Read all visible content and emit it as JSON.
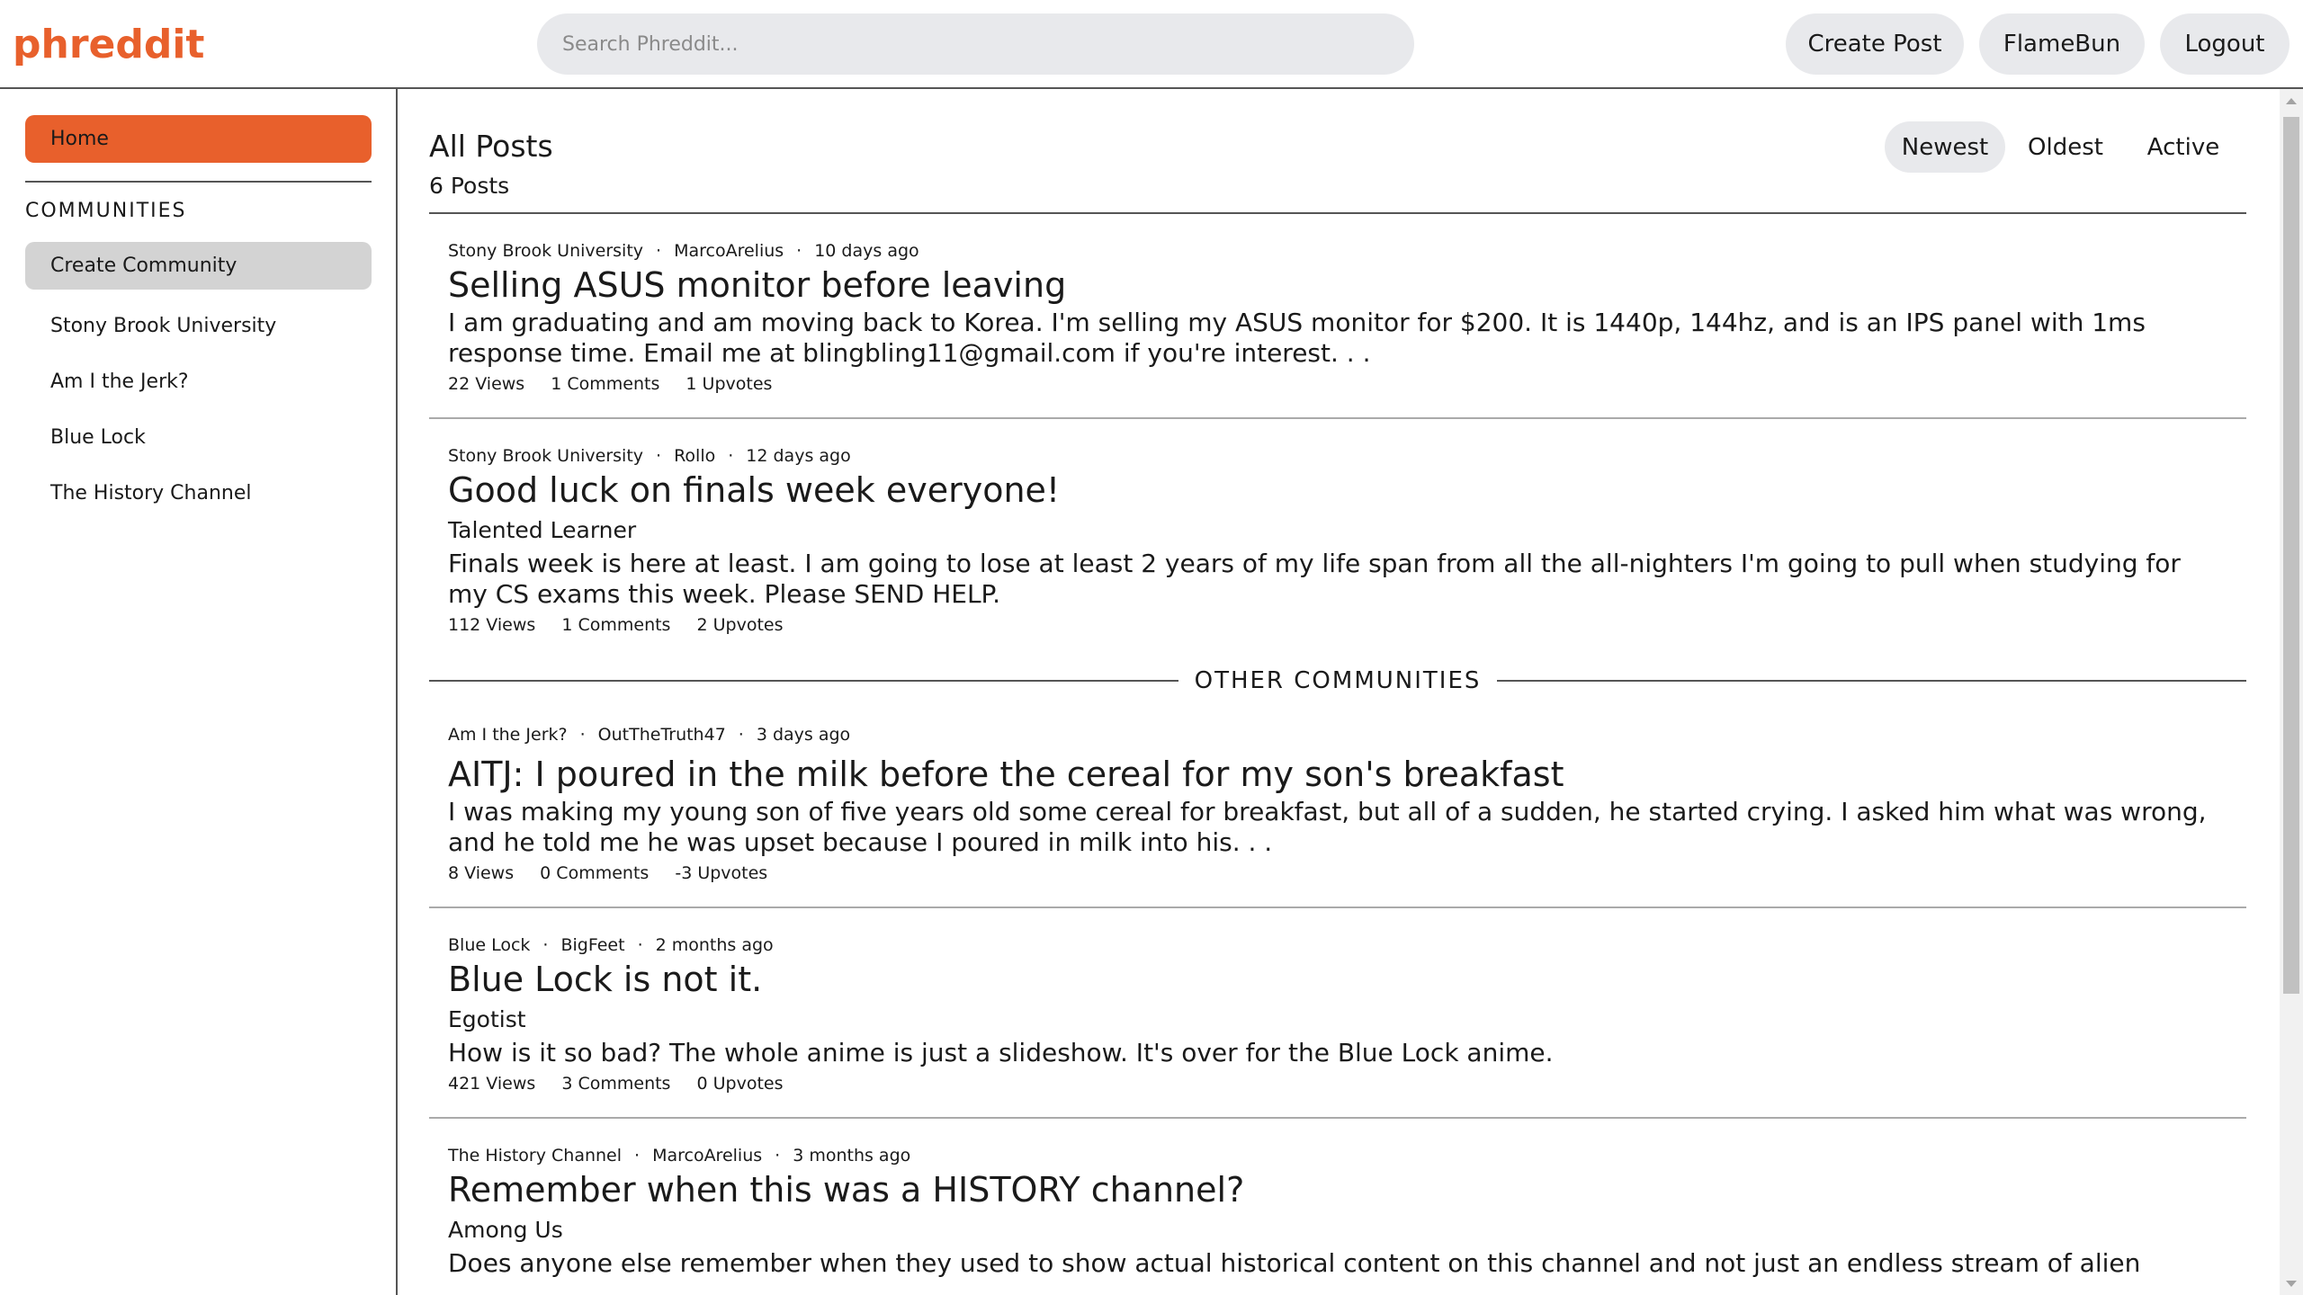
{
  "header": {
    "logo": "phreddit",
    "search_placeholder": "Search Phreddit...",
    "create_post": "Create Post",
    "username": "FlameBun",
    "logout": "Logout"
  },
  "sidebar": {
    "home": "Home",
    "communities_heading": "COMMUNITIES",
    "create_community": "Create Community",
    "communities": [
      "Stony Brook University",
      "Am I the Jerk?",
      "Blue Lock",
      "The History Channel"
    ]
  },
  "main": {
    "title": "All Posts",
    "post_count": "6 Posts",
    "sort": {
      "newest": "Newest",
      "oldest": "Oldest",
      "active": "Active",
      "selected": "Newest"
    },
    "other_communities_label": "OTHER COMMUNITIES",
    "posts": [
      {
        "community": "Stony Brook University",
        "author": "MarcoArelius",
        "time": "10 days ago",
        "title": "Selling ASUS monitor before leaving",
        "flair": "",
        "body": "I am graduating and am moving back to Korea. I'm selling my ASUS monitor for $200. It is 1440p, 144hz, and is an IPS panel with 1ms response time. Email me at blingbling11@gmail.com if you're interest. . .",
        "views": "22 Views",
        "comments": "1 Comments",
        "upvotes": "1 Upvotes"
      },
      {
        "community": "Stony Brook University",
        "author": "Rollo",
        "time": "12 days ago",
        "title": "Good luck on finals week everyone!",
        "flair": "Talented Learner",
        "body": "Finals week is here at least. I am going to lose at least 2 years of my life span from all the all-nighters I'm going to pull when studying for my CS exams this week. Please SEND HELP.",
        "views": "112 Views",
        "comments": "1 Comments",
        "upvotes": "2 Upvotes"
      },
      {
        "community": "Am I the Jerk?",
        "author": "OutTheTruth47",
        "time": "3 days ago",
        "title": "AITJ: I poured in the milk before the cereal for my son's breakfast",
        "flair": "",
        "body": "I was making my young son of five years old some cereal for breakfast, but all of a sudden, he started crying. I asked him what was wrong, and he told me he was upset because I poured in milk into his. . .",
        "views": "8 Views",
        "comments": "0 Comments",
        "upvotes": "-3 Upvotes"
      },
      {
        "community": "Blue Lock",
        "author": "BigFeet",
        "time": "2 months ago",
        "title": "Blue Lock is not it.",
        "flair": "Egotist",
        "body": "How is it so bad? The whole anime is just a slideshow. It's over for the Blue Lock anime.",
        "views": "421 Views",
        "comments": "3 Comments",
        "upvotes": "0 Upvotes"
      },
      {
        "community": "The History Channel",
        "author": "MarcoArelius",
        "time": "3 months ago",
        "title": "Remember when this was a HISTORY channel?",
        "flair": "Among Us",
        "body": "Does anyone else remember when they used to show actual historical content on this channel and not just an endless stream of alien",
        "views": "",
        "comments": "",
        "upvotes": ""
      }
    ]
  },
  "colors": {
    "brand": "#e8602c",
    "pill_bg": "#e8e9ec",
    "create_community_bg": "#d3d3d3"
  },
  "icons": {
    "scroll_up": "scroll-up-arrow-icon",
    "scroll_down": "scroll-down-arrow-icon"
  }
}
